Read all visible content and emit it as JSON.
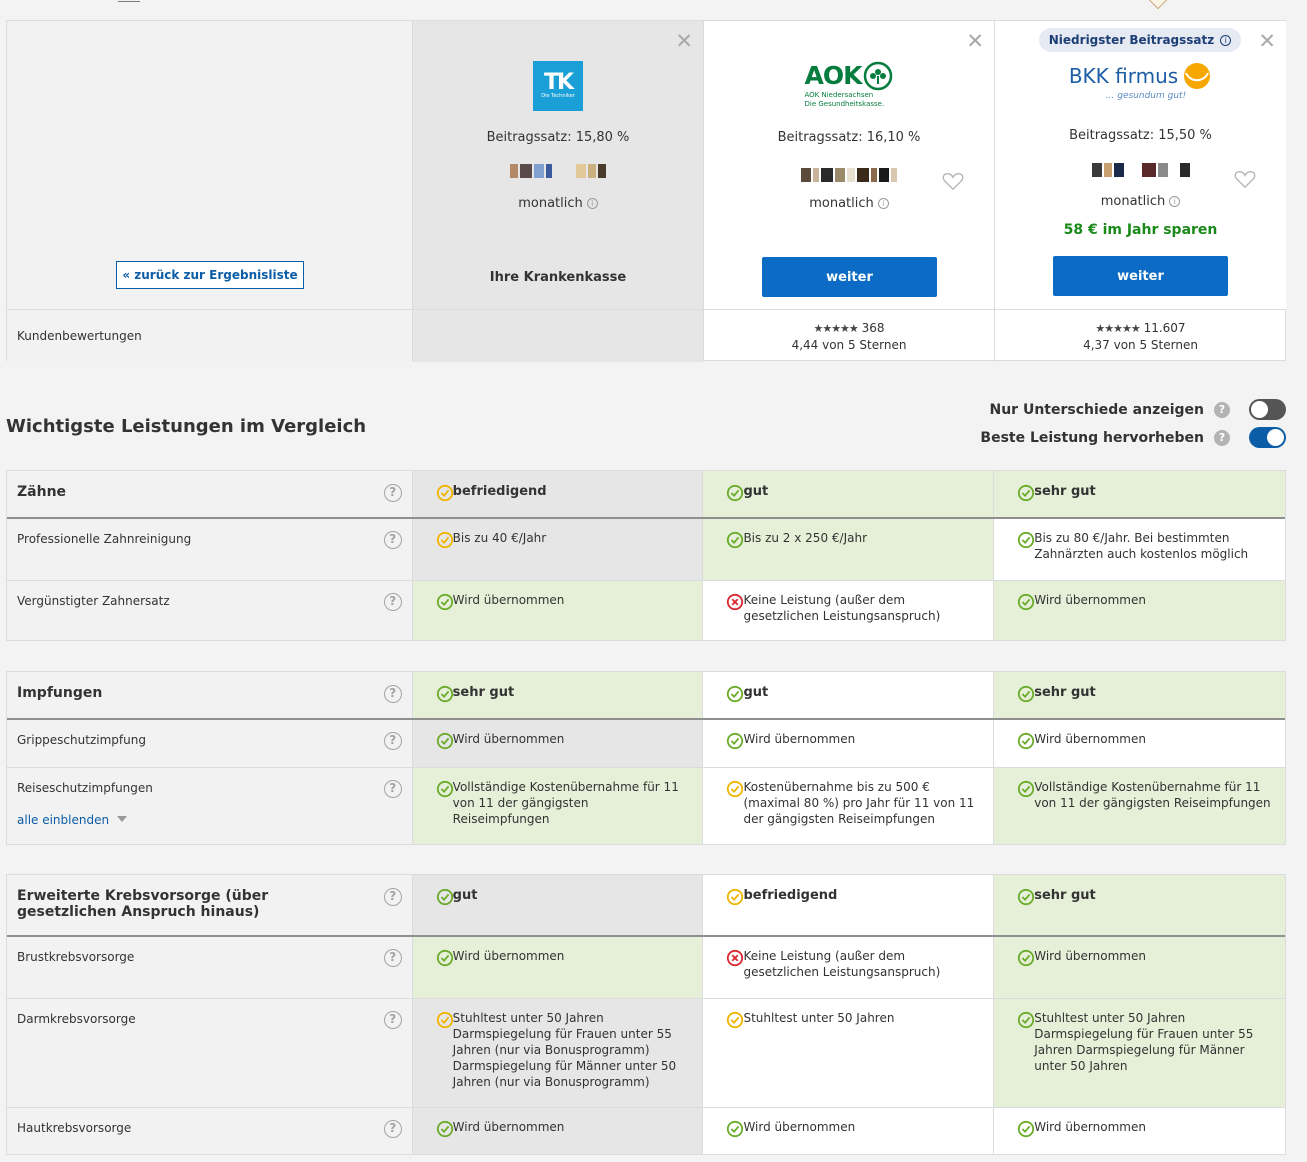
{
  "header": {
    "back_label": "« zurück zur Ergebnisliste",
    "reviews_label": "Kundenbewertungen",
    "best_badge": "Niedrigster Beitragssatz",
    "columns": [
      {
        "logo": "TK",
        "logo_sub": "Die Techniker",
        "rate": "Beitragssatz: 15,80 %",
        "monthly": "monatlich",
        "own_label": "Ihre Krankenkasse",
        "rating_stars": "",
        "rating_count": "",
        "rating_text": ""
      },
      {
        "logo": "AOK",
        "logo_sub": "AOK Niedersachsen",
        "logo_sub2": "Die Gesundheitskasse.",
        "rate": "Beitragssatz: 16,10 %",
        "monthly": "monatlich",
        "button": "weiter",
        "rating_stars": "★★★★★",
        "rating_count": "368",
        "rating_text": "4,44 von 5 Sternen"
      },
      {
        "logo": "BKK firmus",
        "logo_sub": "... gesundum gut!",
        "rate": "Beitragssatz: 15,50 %",
        "monthly": "monatlich",
        "savings": "58 € im Jahr sparen",
        "button": "weiter",
        "rating_stars": "★★★★★",
        "rating_count": "11.607",
        "rating_text": "4,37 von 5 Sternen"
      }
    ]
  },
  "section_title": "Wichtigste Leistungen im Vergleich",
  "toggles": [
    {
      "label": "Nur Unterschiede anzeigen",
      "state": "off"
    },
    {
      "label": "Beste Leistung hervorheben",
      "state": "on"
    }
  ],
  "icons": {
    "ok_green": "#6aab2a",
    "ok_yellow": "#f0b400",
    "no_red": "#d9262c",
    "accent": "#0c5da8"
  },
  "tables": [
    {
      "category": "Zähne",
      "head": [
        "befriedigend",
        "gut",
        "sehr gut"
      ],
      "rows": [
        {
          "label": "Professionelle Zahnreinigung",
          "cells": [
            "Bis zu 40 €/Jahr",
            "Bis zu 2 x 250 €/Jahr",
            "Bis zu 80 €/Jahr. Bei bestimmten Zahnärzten auch kostenlos möglich"
          ]
        },
        {
          "label": "Vergünstigter Zahnersatz",
          "cells": [
            "Wird übernommen",
            "Keine Leistung (außer dem gesetzlichen Leistungsanspruch)",
            "Wird übernommen"
          ]
        }
      ]
    },
    {
      "category": "Impfungen",
      "head": [
        "sehr gut",
        "gut",
        "sehr gut"
      ],
      "rows": [
        {
          "label": "Grippeschutzimpfung",
          "cells": [
            "Wird übernommen",
            "Wird übernommen",
            "Wird übernommen"
          ]
        },
        {
          "label": "Reiseschutzimpfungen",
          "expand": "alle einblenden",
          "cells": [
            "Vollständige Kostenübernahme für 11 von 11 der gängigsten Reiseimpfungen",
            "Kostenübernahme bis zu 500 € (maximal 80 %) pro Jahr für 11 von 11 der gängigsten Reiseimpfungen",
            "Vollständige Kostenübernahme für 11 von 11 der gängigsten Reiseimpfungen"
          ]
        }
      ]
    },
    {
      "category": "Erweiterte Krebsvorsorge (über gesetzlichen Anspruch hinaus)",
      "head": [
        "gut",
        "befriedigend",
        "sehr gut"
      ],
      "rows": [
        {
          "label": "Brustkrebsvorsorge",
          "cells": [
            "Wird übernommen",
            "Keine Leistung (außer dem gesetzlichen Leistungsanspruch)",
            "Wird übernommen"
          ]
        },
        {
          "label": "Darmkrebsvorsorge",
          "cells": [
            "Stuhltest unter 50 Jahren Darmspiegelung für Frauen unter 55 Jahren (nur via Bonusprogramm) Darmspiegelung für Männer unter 50 Jahren (nur via Bonusprogramm)",
            "Stuhltest unter 50 Jahren",
            "Stuhltest unter 50 Jahren Darmspiegelung für Frauen unter 55 Jahren Darmspiegelung für Männer unter 50 Jahren"
          ]
        },
        {
          "label": "Hautkrebsvorsorge",
          "cells": [
            "Wird übernommen",
            "Wird übernommen",
            "Wird übernommen"
          ]
        }
      ]
    }
  ]
}
